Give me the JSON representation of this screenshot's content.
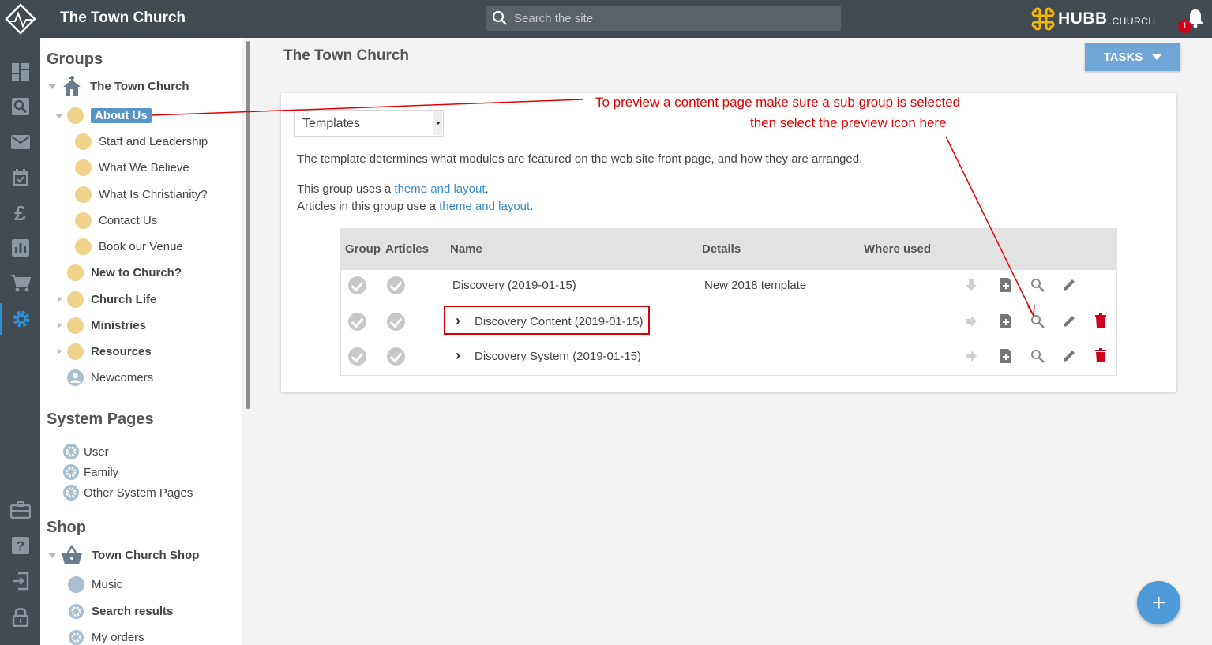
{
  "app": {
    "title": "The Town Church"
  },
  "search": {
    "placeholder": "Search the site"
  },
  "brand": {
    "name_bold": "HUBB",
    "name_suffix": ".CHURCH"
  },
  "notifications": {
    "count": "1"
  },
  "rail": {
    "icons": [
      "dashboard-icon",
      "search-icon",
      "mail-icon",
      "calendar-icon",
      "pound-icon",
      "chart-icon",
      "cart-icon",
      "gear-icon",
      "briefcase-icon",
      "help-icon",
      "signout-icon",
      "lock-icon"
    ]
  },
  "tree": {
    "groups_title": "Groups",
    "root": "The Town Church",
    "selected": "About Us",
    "children": [
      "Staff and Leadership",
      "What We Believe",
      "What Is Christianity?",
      "Contact Us",
      "Book our Venue"
    ],
    "top_items": [
      "New to Church?",
      "Church Life",
      "Ministries",
      "Resources",
      "Newcomers"
    ],
    "system_title": "System Pages",
    "system_items": [
      "User",
      "Family",
      "Other System Pages"
    ],
    "shop_title": "Shop",
    "shop_root": "Town Church Shop",
    "shop_items": [
      "Music",
      "Search results",
      "My orders"
    ]
  },
  "main": {
    "title": "The Town Church",
    "tasks_label": "TASKS",
    "select_value": "Templates",
    "description": "The template determines what modules are featured on the web site front page, and how they are arranged.",
    "group_line_prefix": "This group uses a ",
    "articles_line_prefix": "Articles in this group use a ",
    "theme_link": "theme and layout",
    "period": "."
  },
  "table": {
    "headers": [
      "Group",
      "Articles",
      "Name",
      "Details",
      "Where used"
    ],
    "rows": [
      {
        "name": "Discovery (2019-01-15)",
        "details": "New 2018 template",
        "expandable": false,
        "deletable": false
      },
      {
        "name": "Discovery Content (2019-01-15)",
        "details": "",
        "expandable": true,
        "deletable": true
      },
      {
        "name": "Discovery System (2019-01-15)",
        "details": "",
        "expandable": true,
        "deletable": true
      }
    ]
  },
  "annotation": {
    "line1": "To preview a content page make sure a sub group is selected",
    "line2": "then select the preview icon here",
    "color": "#e30000"
  },
  "fab": {
    "label": "+"
  },
  "colors": {
    "topbar": "#424a52",
    "accent": "#5595c7",
    "folder": "#f0d38a",
    "delete": "#d0021b"
  }
}
